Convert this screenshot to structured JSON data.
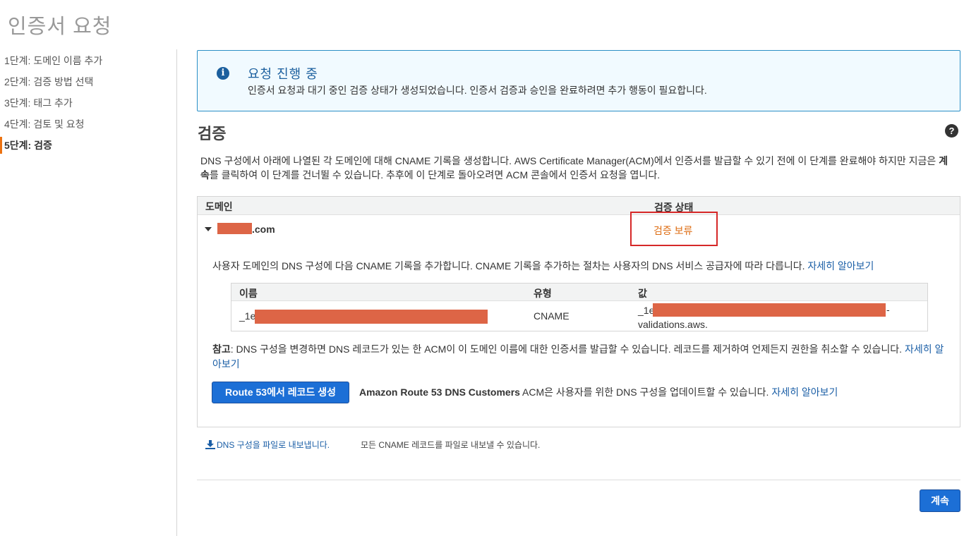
{
  "page_title": "인증서 요청",
  "steps": [
    {
      "label": "1단계: 도메인 이름 추가"
    },
    {
      "label": "2단계: 검증 방법 선택"
    },
    {
      "label": "3단계: 태그 추가"
    },
    {
      "label": "4단계: 검토 및 요청"
    },
    {
      "label": "5단계: 검증"
    }
  ],
  "info": {
    "title": "요청 진행 중",
    "description": "인증서 요청과 대기 중인 검증 상태가 생성되었습니다. 인증서 검증과 승인을 완료하려면 추가 행동이 필요합니다.",
    "icon": "info-icon"
  },
  "section": {
    "title": "검증",
    "description_part1": "DNS 구성에서 아래에 나열된 각 도메인에 대해 CNAME 기록을 생성합니다. AWS Certificate Manager(ACM)에서 인증서를 발급할 수 있기 전에 이 단계를 완료해야 하지만 지금은 ",
    "description_bold": "계속",
    "description_part2": "를 클릭하여 이 단계를 건너뛸 수 있습니다. 추후에 이 단계로 돌아오려면 ACM 콘솔에서 인증서 요청을 엽니다."
  },
  "domain_table": {
    "col_domain": "도메인",
    "col_status": "검증 상태",
    "domain_suffix": ".com",
    "status": "검증 보류",
    "status_color": "#dd6b10"
  },
  "cname": {
    "description": "사용자 도메인의 DNS 구성에 다음 CNAME 기록을 추가합니다. CNAME 기록을 추가하는 절차는 사용자의 DNS 서비스 공급자에 따라 다릅니다. ",
    "learn_more": "자세히 알아보기",
    "col_name": "이름",
    "col_type": "유형",
    "col_value": "값",
    "name_prefix": "_1e",
    "type": "CNAME",
    "value_prefix": "_1e",
    "value_suffix": "-",
    "value_line2": "validations.aws."
  },
  "note": {
    "label": "참고",
    "text": ": DNS 구성을 변경하면 DNS 레코드가 있는 한 ACM이 이 도메인 이름에 대한 인증서를 발급할 수 있습니다. 레코드를 제거하여 언제든지 권한을 취소할 수 있습니다. ",
    "learn_more": "자세히 알아보기"
  },
  "route53": {
    "button": "Route 53에서 레코드 생성",
    "bold": "Amazon Route 53 DNS Customers",
    "text": " ACM은 사용자를 위한 DNS 구성을 업데이트할 수 있습니다. ",
    "learn_more": "자세히 알아보기"
  },
  "export": {
    "link": "DNS 구성을 파일로 내보냅니다.",
    "description": "모든 CNAME 레코드를 파일로 내보낼 수 있습니다.",
    "icon": "download-icon"
  },
  "continue_button": "계속",
  "colors": {
    "primary_button": "#1c6fd6",
    "link": "#1a5ea6",
    "info_border": "#2b8fc6",
    "redaction": "#dd6546",
    "highlight_box": "#d62828",
    "active_step": "#ec7211"
  }
}
